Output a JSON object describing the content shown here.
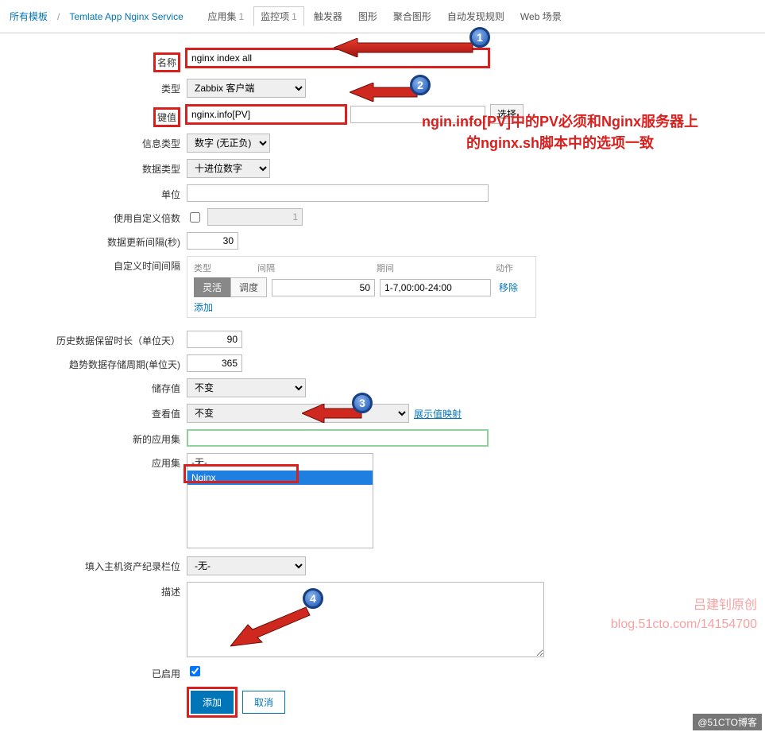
{
  "nav": {
    "all_templates": "所有模板",
    "template_name": "Temlate App Nginx Service",
    "tabs": {
      "appset": "应用集",
      "appset_count": "1",
      "items": "监控项",
      "items_count": "1",
      "triggers": "触发器",
      "graphs": "图形",
      "screens": "聚合图形",
      "discovery": "自动发现规则",
      "web": "Web 场景"
    }
  },
  "labels": {
    "name": "名称",
    "type": "类型",
    "key": "键值",
    "info_type": "信息类型",
    "data_type": "数据类型",
    "unit": "单位",
    "use_multiplier": "使用自定义倍数",
    "update_interval": "数据更新间隔(秒)",
    "custom_intervals": "自定义时间间隔",
    "history": "历史数据保留时长（单位天）",
    "trends": "趋势数据存储周期(单位天)",
    "store_value": "储存值",
    "show_value": "查看值",
    "new_appset": "新的应用集",
    "appset": "应用集",
    "inventory": "填入主机资产纪录栏位",
    "description": "描述",
    "enabled": "已启用"
  },
  "values": {
    "name": "nginx index all",
    "type": "Zabbix 客户端",
    "key": "nginx.info[PV]",
    "select_btn": "选择",
    "info_type": "数字 (无正负)",
    "data_type": "十进位数字",
    "unit": "",
    "multiplier": "1",
    "update_interval": "30",
    "history": "90",
    "trends": "365",
    "store_value": "不变",
    "show_value": "不变",
    "show_value_link": "展示值映射",
    "app_none": "-无-",
    "app_nginx": "Nginx",
    "inventory": "-无-"
  },
  "interval": {
    "head_type": "类型",
    "head_interval": "间隔",
    "head_period": "期间",
    "head_action": "动作",
    "flex": "灵活",
    "sched": "调度",
    "val": "50",
    "period": "1-7,00:00-24:00",
    "remove": "移除",
    "add": "添加"
  },
  "buttons": {
    "add": "添加",
    "cancel": "取消"
  },
  "annotations": {
    "b1": "1",
    "b2": "2",
    "b3": "3",
    "b4": "4",
    "note_line1": "ngin.info[PV]中的PV必须和Nginx服务器上",
    "note_line2": "的nginx.sh脚本中的选项一致"
  },
  "watermark": {
    "l1": "吕建钊原创",
    "l2": "blog.51cto.com/14154700",
    "footer": "@51CTO博客"
  }
}
